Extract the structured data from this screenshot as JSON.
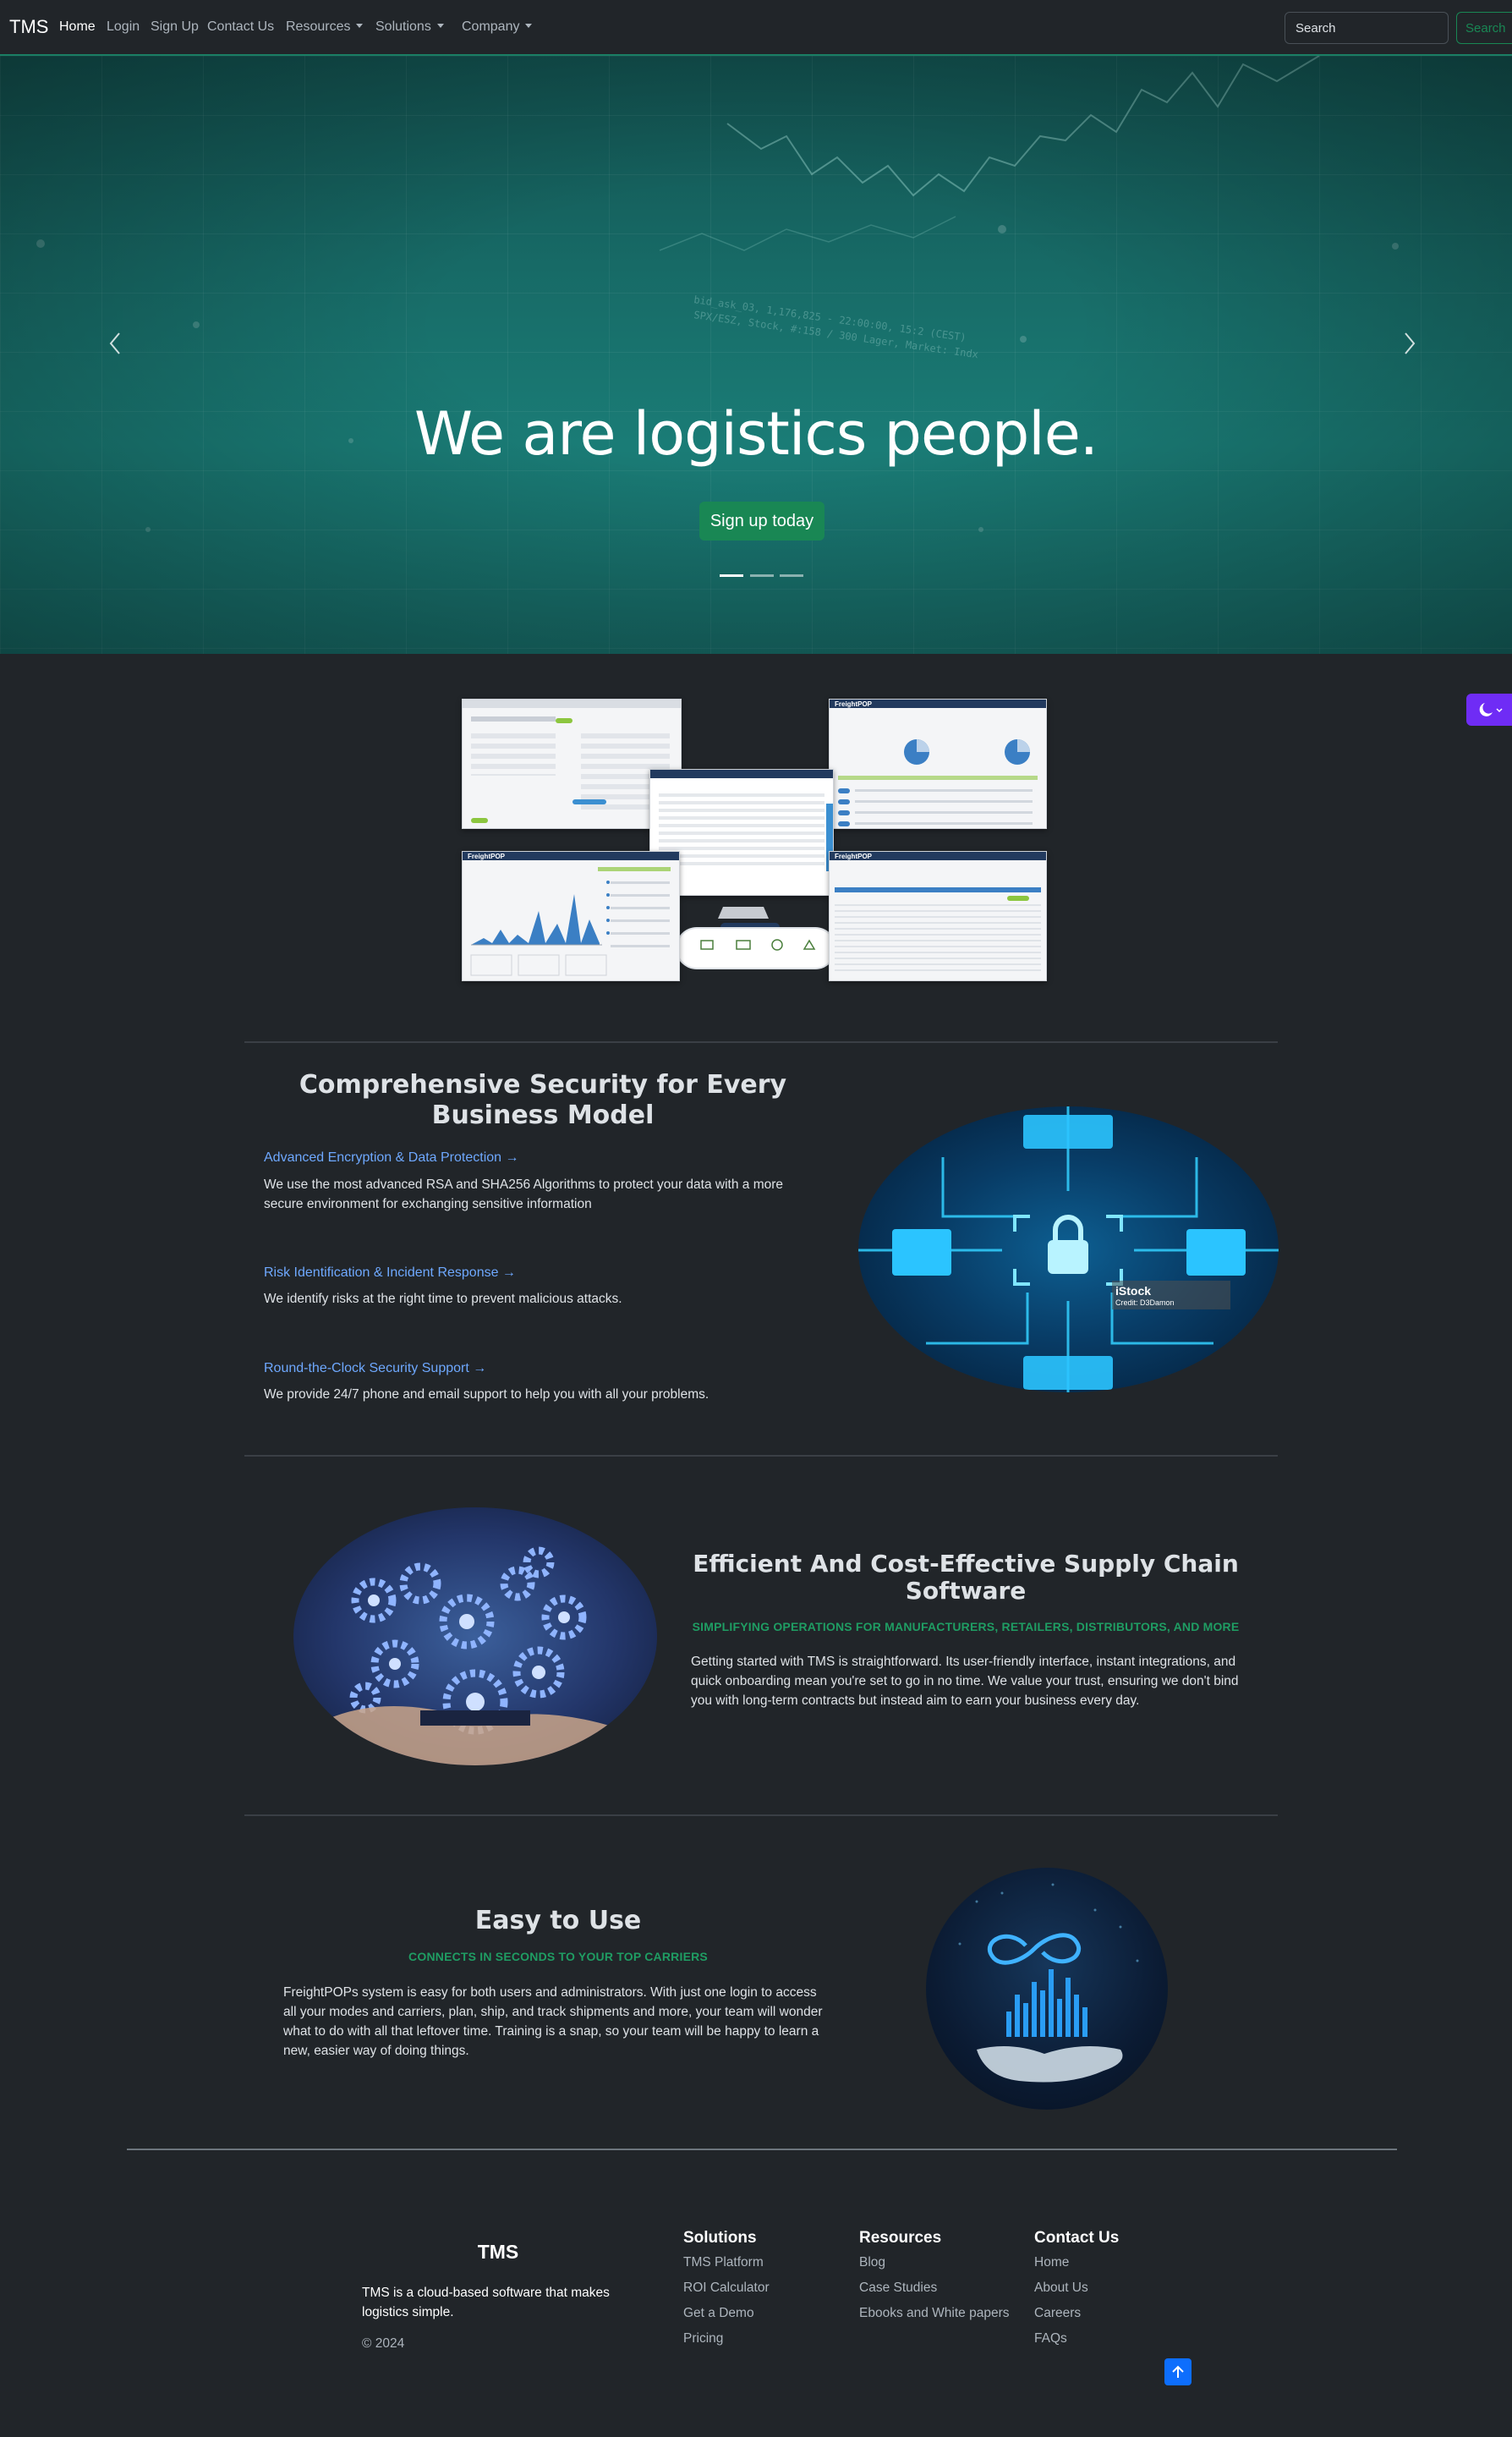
{
  "navbar": {
    "brand": "TMS",
    "links": [
      "Home",
      "Login",
      "Sign Up",
      "Contact Us"
    ],
    "dropdowns": [
      "Resources",
      "Solutions",
      "Company"
    ],
    "search_placeholder": "Search",
    "search_button": "Search"
  },
  "hero": {
    "title": "We are logistics people.",
    "cta": "Sign up today",
    "slides": 3,
    "active_slide": 1,
    "colors": {
      "overlay": "#17706b",
      "cta": "#198754"
    }
  },
  "security": {
    "title": "Comprehensive Security for Every Business Model",
    "features": [
      {
        "link": "Advanced Encryption & Data Protection →",
        "text": "We use the most advanced RSA and SHA256 Algorithms to protect your data with a more secure environment for exchanging sensitive information"
      },
      {
        "link": "Risk Identification & Incident Response →",
        "text": "We identify risks at the right time to prevent malicious attacks."
      },
      {
        "link": "Round-the-Clock Security Support →",
        "text": "We provide 24/7 phone and email support to help you with all your problems."
      }
    ],
    "image_caption": "iStock",
    "image_credit": "Credit: D3Damon"
  },
  "supply_chain": {
    "title": "Efficient And Cost-Effective Supply Chain Software",
    "subtitle": "Simplifying operations for manufacturers, retailers, distributors, and more",
    "text": "Getting started with TMS is straightforward. Its user-friendly interface, instant integrations, and quick onboarding mean you're set to go in no time. We value your trust, ensuring we don't bind you with long-term contracts but instead aim to earn your business every day."
  },
  "easy": {
    "title": "Easy to Use",
    "subtitle": "Connects in seconds to your top carriers",
    "text": "FreightPOPs system is easy for both users and administrators. With just one login to access all your modes and carriers, plan, ship, and track shipments and more, your team will wonder what to do with all that leftover time. Training is a snap, so your team will be happy to learn a new, easier way of doing things."
  },
  "footer": {
    "brand": "TMS",
    "tagline": "TMS is a cloud-based software that makes logistics simple.",
    "copyright": "© 2024",
    "columns": [
      {
        "title": "Solutions",
        "links": [
          "TMS Platform",
          "ROI Calculator",
          "Get a Demo",
          "Pricing"
        ]
      },
      {
        "title": "Resources",
        "links": [
          "Blog",
          "Case Studies",
          "Ebooks and White papers"
        ]
      },
      {
        "title": "Contact Us",
        "links": [
          "Home",
          "About Us",
          "Careers",
          "FAQs"
        ]
      }
    ]
  },
  "mockup_label": "FreightPOP",
  "icons": [
    "chevron-left-icon",
    "chevron-right-icon",
    "moon-icon",
    "arrow-up-icon",
    "lock-icon",
    "gears-icon",
    "infinity-icon"
  ]
}
